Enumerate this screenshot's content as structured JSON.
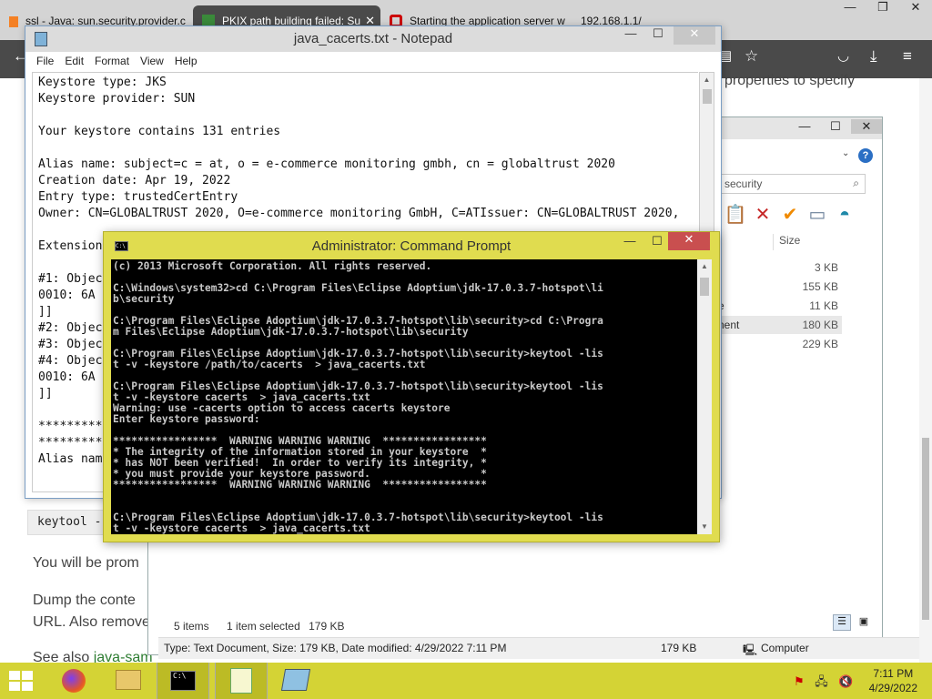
{
  "browser": {
    "tabs": [
      {
        "label": "ssl - Java: sun.security.provider.c"
      },
      {
        "label": "PKIX path building failed: Su"
      },
      {
        "label": "Starting the application server w"
      },
      {
        "label": "192.168.1.1/"
      }
    ],
    "window_buttons": {
      "minimize": "—",
      "maximize": "❐",
      "close": "✕"
    },
    "page": {
      "partial_text_right": "properties to specify",
      "code_snippet": "keytool -",
      "para1": "You will be prom",
      "para2_line1": "Dump the conte",
      "para2_line2": "URL. Also remove",
      "see_also_prefix": "See also ",
      "see_also_link": "java-sam"
    }
  },
  "explorer": {
    "search_placeholder": "security",
    "help_label": "?",
    "column_size": "Size",
    "rows": [
      {
        "name": "",
        "size": "3 KB",
        "selected": false
      },
      {
        "name": "",
        "size": "155 KB",
        "selected": false
      },
      {
        "name": "e",
        "size": "11 KB",
        "selected": false
      },
      {
        "name": "nent",
        "size": "180 KB",
        "selected": true
      },
      {
        "name": "",
        "size": "229 KB",
        "selected": false
      }
    ],
    "status": {
      "items": "5 items",
      "selected": "1 item selected",
      "size": "179 KB"
    },
    "statusbar": {
      "details": "Type: Text Document, Size: 179 KB, Date modified: 4/29/2022 7:11 PM",
      "size": "179 KB",
      "location": "Computer"
    }
  },
  "notepad": {
    "title": "java_cacerts.txt - Notepad",
    "menu": [
      "File",
      "Edit",
      "Format",
      "View",
      "Help"
    ],
    "lines": [
      "Keystore type: JKS",
      "Keystore provider: SUN",
      "",
      "Your keystore contains 131 entries",
      "",
      "Alias name: subject=c = at, o = e-commerce monitoring gmbh, cn = globaltrust 2020",
      "Creation date: Apr 19, 2022",
      "Entry type: trustedCertEntry",
      "Owner: CN=GLOBALTRUST 2020, O=e-commerce monitoring GmbH, C=ATIssuer: CN=GLOBALTRUST 2020,",
      "",
      "Extension",
      "",
      "#1: Objec",
      "0010: 6A",
      "]]",
      "#2: Objec",
      "#3: Objec",
      "#4: Objec",
      "0010: 6A",
      "]]",
      "",
      "*********",
      "*********",
      "Alias nam"
    ]
  },
  "cmd": {
    "title": "Administrator: Command Prompt",
    "icon_text": "C:\\",
    "lines": [
      "(c) 2013 Microsoft Corporation. All rights reserved.",
      "",
      "C:\\Windows\\system32>cd C:\\Program Files\\Eclipse Adoptium\\jdk-17.0.3.7-hotspot\\li",
      "b\\security",
      "",
      "C:\\Program Files\\Eclipse Adoptium\\jdk-17.0.3.7-hotspot\\lib\\security>cd C:\\Progra",
      "m Files\\Eclipse Adoptium\\jdk-17.0.3.7-hotspot\\lib\\security",
      "",
      "C:\\Program Files\\Eclipse Adoptium\\jdk-17.0.3.7-hotspot\\lib\\security>keytool -lis",
      "t -v -keystore /path/to/cacerts  > java_cacerts.txt",
      "",
      "C:\\Program Files\\Eclipse Adoptium\\jdk-17.0.3.7-hotspot\\lib\\security>keytool -lis",
      "t -v -keystore cacerts  > java_cacerts.txt",
      "Warning: use -cacerts option to access cacerts keystore",
      "Enter keystore password:",
      "",
      "*****************  WARNING WARNING WARNING  *****************",
      "* The integrity of the information stored in your keystore  *",
      "* has NOT been verified!  In order to verify its integrity, *",
      "* you must provide your keystore password.                  *",
      "*****************  WARNING WARNING WARNING  *****************",
      "",
      "",
      "C:\\Program Files\\Eclipse Adoptium\\jdk-17.0.3.7-hotspot\\lib\\security>keytool -lis",
      "t -v -keystore cacerts  > java_cacerts.txt"
    ]
  },
  "taskbar": {
    "apps": [
      "firefox-icon",
      "file-explorer-icon",
      "cmd-icon",
      "notepad-plus-icon",
      "notepad-icon"
    ],
    "clock_time": "7:11 PM",
    "clock_date": "4/29/2022"
  },
  "colors": {
    "cmd_frame": "#e0dc4f",
    "taskbar": "#d4d335",
    "notepad_border": "#7a9ec4",
    "link": "#2e7d32"
  }
}
